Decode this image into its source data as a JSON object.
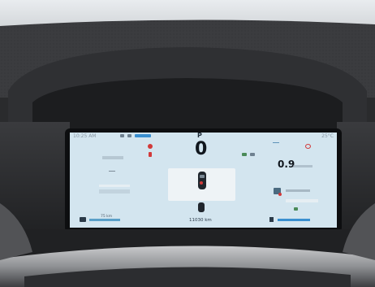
{
  "screen": {
    "time": "10:25 AM",
    "gear": "P",
    "speed": "0",
    "power": "0.9",
    "odometer": "11030 km",
    "temperature": "25°C",
    "range": "75 km"
  },
  "colors": {
    "screen_bg": "#d3e5ef",
    "warning_red": "#d23a3a",
    "accent_blue": "#3a8fd0"
  },
  "icons": [
    "seatbelt-warning-icon",
    "car-top-view-icon",
    "headlight-icon",
    "tire-pressure-icon",
    "battery-icon",
    "charging-icon"
  ]
}
